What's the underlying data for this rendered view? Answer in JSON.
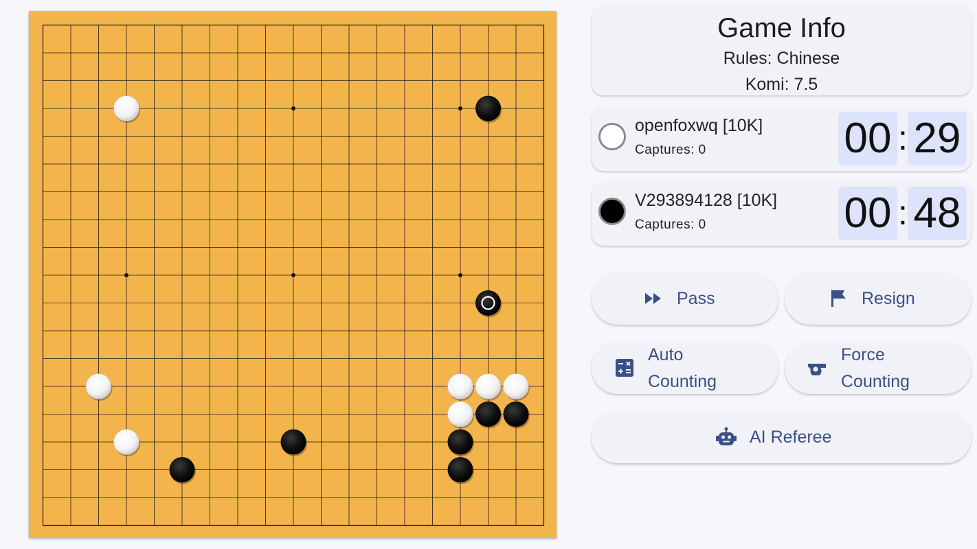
{
  "board": {
    "size": 19,
    "star_points": [
      [
        3,
        3
      ],
      [
        9,
        3
      ],
      [
        15,
        3
      ],
      [
        3,
        9
      ],
      [
        9,
        9
      ],
      [
        15,
        9
      ],
      [
        3,
        15
      ],
      [
        9,
        15
      ],
      [
        15,
        15
      ]
    ],
    "stones": [
      {
        "col": 3,
        "row": 3,
        "color": "white"
      },
      {
        "col": 16,
        "row": 3,
        "color": "black"
      },
      {
        "col": 16,
        "row": 10,
        "color": "black",
        "last_move": true
      },
      {
        "col": 2,
        "row": 13,
        "color": "white"
      },
      {
        "col": 3,
        "row": 15,
        "color": "white"
      },
      {
        "col": 15,
        "row": 13,
        "color": "white"
      },
      {
        "col": 16,
        "row": 13,
        "color": "white"
      },
      {
        "col": 17,
        "row": 13,
        "color": "white"
      },
      {
        "col": 15,
        "row": 14,
        "color": "white"
      },
      {
        "col": 16,
        "row": 14,
        "color": "black"
      },
      {
        "col": 17,
        "row": 14,
        "color": "black"
      },
      {
        "col": 15,
        "row": 15,
        "color": "black"
      },
      {
        "col": 15,
        "row": 16,
        "color": "black"
      },
      {
        "col": 9,
        "row": 15,
        "color": "black"
      },
      {
        "col": 5,
        "row": 16,
        "color": "black"
      }
    ],
    "colors": {
      "wood": "#f4b44c",
      "line": "#1a1a1a"
    }
  },
  "game_info": {
    "title": "Game Info",
    "rules": "Rules: Chinese",
    "komi": "Komi: 7.5"
  },
  "players": [
    {
      "name": "openfoxwq [10K]",
      "captures": "Captures: 0",
      "color": "white",
      "clock_min": "00",
      "clock_sec": "29"
    },
    {
      "name": "V293894128 [10K]",
      "captures": "Captures: 0",
      "color": "black",
      "clock_min": "00",
      "clock_sec": "48"
    }
  ],
  "clock_separator": ":",
  "buttons": {
    "pass": {
      "label": "Pass",
      "icon": "fast-forward-icon"
    },
    "resign": {
      "label": "Resign",
      "icon": "flag-icon"
    },
    "auto_counting": {
      "label_line1": "Auto",
      "label_line2": "Counting",
      "icon": "calculator-icon"
    },
    "force_counting": {
      "label_line1": "Force",
      "label_line2": "Counting",
      "icon": "whistle-icon"
    },
    "ai_referee": {
      "label": "AI Referee",
      "icon": "robot-icon"
    }
  },
  "accent_color": "#3b5088"
}
